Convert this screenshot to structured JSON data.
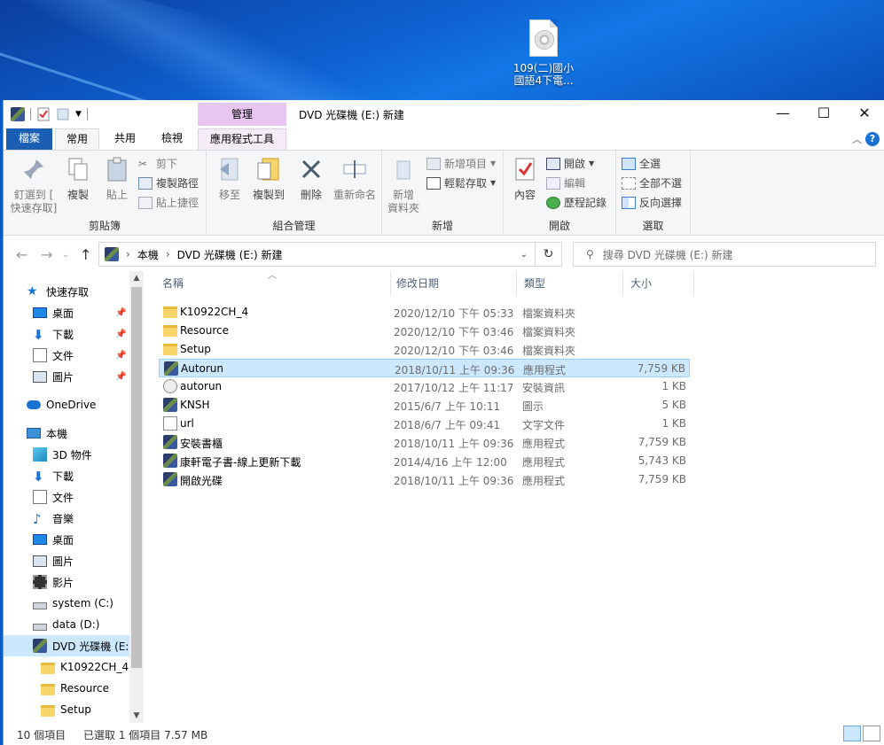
{
  "desktop": {
    "icon_label_line1": "109(二)國小",
    "icon_label_line2": "國語4下電..."
  },
  "window": {
    "title": "DVD 光碟機 (E:) 新建",
    "manage_tab": "管理",
    "controls": {
      "minimize": "—",
      "maximize": "☐",
      "close": "✕"
    }
  },
  "tabs": {
    "file": "檔案",
    "home": "常用",
    "share": "共用",
    "view": "檢視",
    "app_tools": "應用程式工具"
  },
  "ribbon": {
    "clipboard": {
      "label": "剪貼簿",
      "pin_line1": "釘選到 [",
      "pin_line2": "快速存取]",
      "copy": "複製",
      "paste": "貼上",
      "cut": "剪下",
      "copy_path": "複製路徑",
      "paste_shortcut": "貼上捷徑"
    },
    "organize": {
      "label": "組合管理",
      "move_to": "移至",
      "copy_to": "複製到",
      "delete": "刪除",
      "rename": "重新命名"
    },
    "new": {
      "label": "新增",
      "new_folder_line1": "新增",
      "new_folder_line2": "資料夾",
      "new_item": "新增項目",
      "easy_access": "輕鬆存取"
    },
    "open": {
      "label": "開啟",
      "properties": "內容",
      "open": "開啟",
      "edit": "編輯",
      "history": "歷程記錄"
    },
    "select": {
      "label": "選取",
      "select_all": "全選",
      "select_none": "全部不選",
      "invert": "反向選擇"
    }
  },
  "address": {
    "crumbs": [
      "本機",
      "DVD 光碟機 (E:) 新建"
    ],
    "search_placeholder": "搜尋 DVD 光碟機 (E:) 新建"
  },
  "nav": {
    "quick_access": "快速存取",
    "qa_items": [
      "桌面",
      "下載",
      "文件",
      "圖片"
    ],
    "onedrive": "OneDrive",
    "this_pc": "本機",
    "pc_items": [
      "3D 物件",
      "下載",
      "文件",
      "音樂",
      "桌面",
      "圖片",
      "影片",
      "system (C:)",
      "data (D:)",
      "DVD 光碟機 (E:)"
    ],
    "dvd_children": [
      "K10922CH_4",
      "Resource",
      "Setup"
    ]
  },
  "columns": {
    "name": "名稱",
    "date": "修改日期",
    "type": "類型",
    "size": "大小"
  },
  "files": [
    {
      "name": "K10922CH_4",
      "date": "2020/12/10 下午 05:33",
      "type": "檔案資料夾",
      "size": "",
      "icon": "folder-icon"
    },
    {
      "name": "Resource",
      "date": "2020/12/10 下午 03:46",
      "type": "檔案資料夾",
      "size": "",
      "icon": "folder-icon"
    },
    {
      "name": "Setup",
      "date": "2020/12/10 下午 03:46",
      "type": "檔案資料夾",
      "size": "",
      "icon": "folder-icon"
    },
    {
      "name": "Autorun",
      "date": "2018/10/11 上午 09:36",
      "type": "應用程式",
      "size": "7,759 KB",
      "icon": "app-icon"
    },
    {
      "name": "autorun",
      "date": "2017/10/12 上午 11:17",
      "type": "安裝資訊",
      "size": "1 KB",
      "icon": "setup-info-icon"
    },
    {
      "name": "KNSH",
      "date": "2015/6/7 上午 10:11",
      "type": "圖示",
      "size": "5 KB",
      "icon": "app-icon"
    },
    {
      "name": "url",
      "date": "2018/6/7 上午 09:41",
      "type": "文字文件",
      "size": "1 KB",
      "icon": "text-file-icon"
    },
    {
      "name": "安裝書櫃",
      "date": "2018/10/11 上午 09:36",
      "type": "應用程式",
      "size": "7,759 KB",
      "icon": "app-icon"
    },
    {
      "name": "康軒電子書-線上更新下載",
      "date": "2014/4/16 上午 12:00",
      "type": "應用程式",
      "size": "5,743 KB",
      "icon": "app-icon"
    },
    {
      "name": "開啟光碟",
      "date": "2018/10/11 上午 09:36",
      "type": "應用程式",
      "size": "7,759 KB",
      "icon": "app-icon"
    }
  ],
  "status": {
    "count": "10 個項目",
    "selected": "已選取 1 個項目  7.57 MB"
  }
}
